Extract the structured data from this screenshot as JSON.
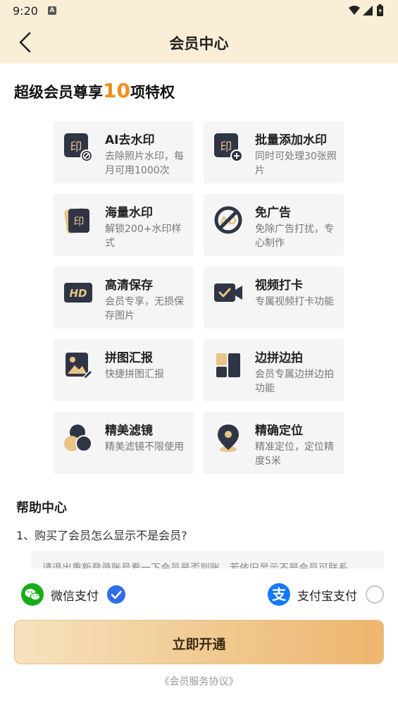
{
  "status": {
    "time": "9:20",
    "notify_glyph": "A"
  },
  "nav": {
    "title": "会员中心"
  },
  "hero": {
    "prefix": "超级会员尊享",
    "count": "10",
    "suffix": "项特权"
  },
  "features": [
    {
      "title": "AI去水印",
      "desc": "去除照片水印，每月可用1000次",
      "icon": "stamp-remove-icon"
    },
    {
      "title": "批量添加水印",
      "desc": "同时可处理30张照片",
      "icon": "stamp-add-icon"
    },
    {
      "title": "海量水印",
      "desc": "解锁200+水印样式",
      "icon": "stamp-stack-icon"
    },
    {
      "title": "免广告",
      "desc": "免除广告打扰，专心制作",
      "icon": "no-ad-icon"
    },
    {
      "title": "高清保存",
      "desc": "会员专享，无损保存图片",
      "icon": "hd-icon"
    },
    {
      "title": "视频打卡",
      "desc": "专属视频打卡功能",
      "icon": "video-check-icon"
    },
    {
      "title": "拼图汇报",
      "desc": "快捷拼图汇报",
      "icon": "collage-icon"
    },
    {
      "title": "边拼边拍",
      "desc": "会员专属边拼边拍功能",
      "icon": "split-layout-icon"
    },
    {
      "title": "精美滤镜",
      "desc": "精美滤镜不限使用",
      "icon": "filter-icon"
    },
    {
      "title": "精确定位",
      "desc": "精准定位，定位精度5米",
      "icon": "location-pin-icon"
    }
  ],
  "help": {
    "title": "帮助中心",
    "question": "1、购买了会员怎么显示不是会员?",
    "answer": "请退出重新登录账号看一下会员是否到账，若依旧显示不是会员可联系"
  },
  "payment": {
    "wechat_label": "微信支付",
    "alipay_label": "支付宝支付",
    "wechat_selected": true,
    "alipay_selected": false
  },
  "cta": {
    "label": "立即开通"
  },
  "agreement": {
    "label": "《会员服务协议》"
  },
  "colors": {
    "accent": "#f08d1a",
    "header_bg": "#fbeed7",
    "wechat": "#1aad19",
    "alipay": "#1677ff",
    "radio_selected": "#2f6ee8",
    "icon_dark": "#2f3545",
    "icon_gold": "#e8c487"
  }
}
